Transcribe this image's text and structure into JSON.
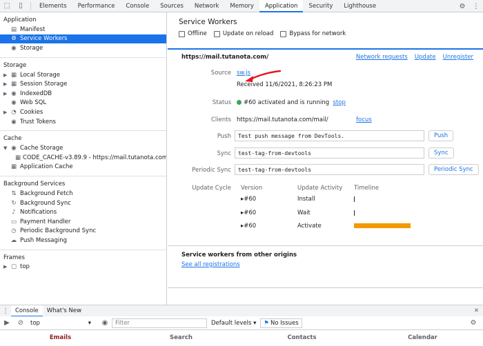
{
  "tabs": [
    "Elements",
    "Performance",
    "Console",
    "Sources",
    "Network",
    "Memory",
    "Application",
    "Security",
    "Lighthouse"
  ],
  "sidebar": {
    "application": {
      "title": "Application",
      "items": [
        "Manifest",
        "Service Workers",
        "Storage"
      ]
    },
    "storage": {
      "title": "Storage",
      "items": [
        "Local Storage",
        "Session Storage",
        "IndexedDB",
        "Web SQL",
        "Cookies",
        "Trust Tokens"
      ]
    },
    "cache": {
      "title": "Cache",
      "items": [
        "Cache Storage",
        "CODE_CACHE-v3.89.9 - https://mail.tutanota.com",
        "Application Cache"
      ]
    },
    "bg": {
      "title": "Background Services",
      "items": [
        "Background Fetch",
        "Background Sync",
        "Notifications",
        "Payment Handler",
        "Periodic Background Sync",
        "Push Messaging"
      ]
    },
    "frames": {
      "title": "Frames",
      "items": [
        "top"
      ]
    }
  },
  "main": {
    "title": "Service Workers",
    "options": [
      "Offline",
      "Update on reload",
      "Bypass for network"
    ],
    "origin": "https://mail.tutanota.com/",
    "actions": [
      "Network requests",
      "Update",
      "Unregister"
    ],
    "source_label": "Source",
    "source_file": "sw.js",
    "received": "Received 11/6/2021, 8:26:23 PM",
    "status_label": "Status",
    "status_text": "#60 activated and is running",
    "status_stop": "stop",
    "clients_label": "Clients",
    "clients_value": "https://mail.tutanota.com/mail/",
    "clients_focus": "focus",
    "push_label": "Push",
    "push_value": "Test push message from DevTools.",
    "push_btn": "Push",
    "sync_label": "Sync",
    "sync_value": "test-tag-from-devtools",
    "sync_btn": "Sync",
    "psync_label": "Periodic Sync",
    "psync_value": "test-tag-from-devtools",
    "psync_btn": "Periodic Sync",
    "uc_label": "Update Cycle",
    "uc_headers": [
      "Version",
      "Update Activity",
      "Timeline"
    ],
    "uc_rows": [
      {
        "version": "#60",
        "activity": "Install",
        "timeline": 0.0
      },
      {
        "version": "#60",
        "activity": "Wait",
        "timeline": 0.0
      },
      {
        "version": "#60",
        "activity": "Activate",
        "timeline": 1.0
      }
    ],
    "other_title": "Service workers from other origins",
    "other_link": "See all registrations"
  },
  "drawer": {
    "tabs": [
      "Console",
      "What's New"
    ],
    "context": "top",
    "filter_placeholder": "Filter",
    "levels": "Default levels ▾",
    "issues": "No Issues"
  },
  "nav": [
    "Emails",
    "Search",
    "Contacts",
    "Calendar"
  ],
  "colors": {
    "accent": "#1a73e8",
    "timeline": "#f29900",
    "running": "#34a853"
  }
}
